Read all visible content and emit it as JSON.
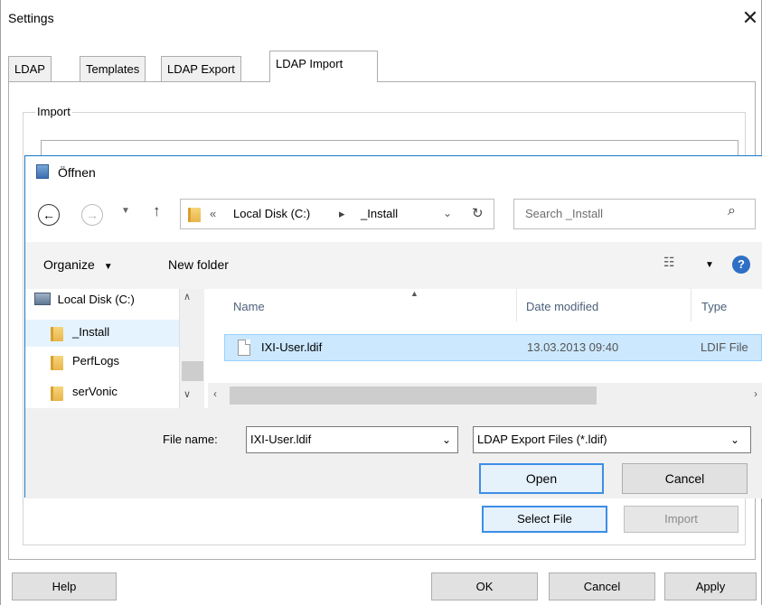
{
  "settings": {
    "title": "Settings",
    "close_glyph": "✕",
    "tabs": [
      {
        "label": "LDAP"
      },
      {
        "label": "Templates"
      },
      {
        "label": "LDAP Export"
      },
      {
        "label": "LDAP Import"
      }
    ],
    "import_group": {
      "legend": "Import"
    },
    "select_file_label": "Select File",
    "import_label": "Import",
    "help_label": "Help",
    "ok_label": "OK",
    "cancel_label": "Cancel",
    "apply_label": "Apply"
  },
  "open_dialog": {
    "title": "Öffnen",
    "breadcrumb": {
      "prefix": "«",
      "segments": [
        "Local Disk (C:)",
        "_Install"
      ],
      "separator": "▸"
    },
    "search_placeholder": "Search _Install",
    "toolbar": {
      "organize_label": "Organize",
      "new_folder_label": "New folder"
    },
    "nav_items": [
      {
        "label": "Local Disk (C:)",
        "icon": "drive-icon"
      },
      {
        "label": "_Install",
        "icon": "folder-icon",
        "selected": true
      },
      {
        "label": "PerfLogs",
        "icon": "folder-icon"
      },
      {
        "label": "serVonic",
        "icon": "folder-icon"
      }
    ],
    "columns": {
      "name": "Name",
      "date": "Date modified",
      "type": "Type"
    },
    "files": [
      {
        "name": "IXI-User.ldif",
        "date": "13.03.2013 09:40",
        "type": "LDIF File",
        "selected": true
      }
    ],
    "file_name_label": "File name:",
    "file_name_value": "IXI-User.ldif",
    "file_type_value": "LDAP Export Files (*.ldif)",
    "open_label": "Open",
    "cancel_label": "Cancel"
  },
  "colors": {
    "accent": "#3d8ee6",
    "selection": "#cce8ff",
    "dialog_border": "#1979ca"
  }
}
